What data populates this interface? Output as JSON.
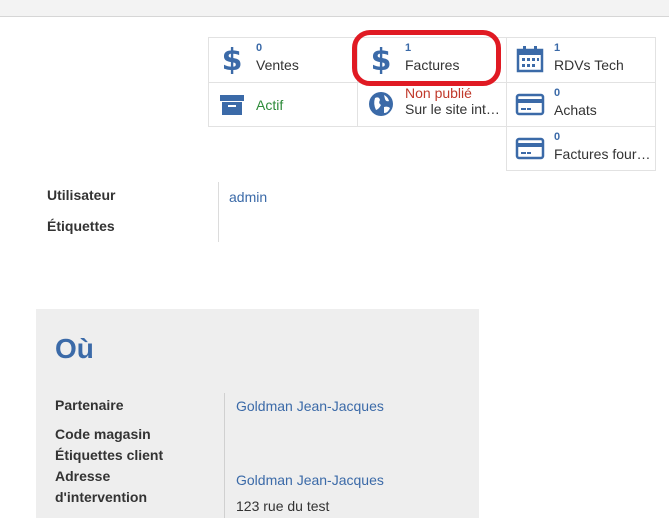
{
  "smart_buttons": {
    "ventes": {
      "count": "0",
      "label": "Ventes"
    },
    "factures": {
      "count": "1",
      "label": "Factures"
    },
    "rdvs": {
      "count": "1",
      "label": "RDVs Tech"
    },
    "actif": {
      "label": "Actif"
    },
    "website": {
      "status": "Non publié",
      "label": "Sur le site int…"
    },
    "achats": {
      "count": "0",
      "label": "Achats"
    },
    "factures_four": {
      "count": "0",
      "label": "Factures four…"
    }
  },
  "fields": {
    "utilisateur_label": "Utilisateur",
    "utilisateur_value": "admin",
    "etiquettes_label": "Étiquettes"
  },
  "ou": {
    "title": "Où",
    "partenaire_label": "Partenaire",
    "partenaire_value": "Goldman Jean-Jacques",
    "code_magasin_label": "Code magasin",
    "etiquettes_client_label": "Étiquettes client",
    "adresse_label_1": "Adresse",
    "adresse_label_2": "d'intervention",
    "adresse_name": "Goldman Jean-Jacques",
    "adresse_street": "123 rue du test"
  },
  "colors": {
    "accent": "#3b6aa8",
    "highlight": "#e01a23",
    "active": "#2e8b3a",
    "unpublished": "#c0392b"
  }
}
